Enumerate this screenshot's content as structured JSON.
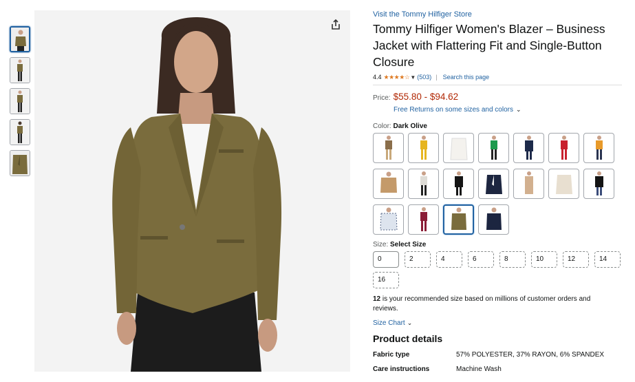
{
  "store_link": "Visit the Tommy Hilfiger Store",
  "product_title": "Tommy Hilfiger Women's Blazer – Business Jacket with Flattering Fit and Single-Button Closure",
  "rating": {
    "value": "4.4",
    "stars": "★★★★☆",
    "stars_out_of_5": 4.4,
    "reviews": "(503)",
    "separator": "|",
    "search_link": "Search this page"
  },
  "price": {
    "label": "Price:",
    "range": "$55.80 - $94.62",
    "returns_text": "Free Returns on some sizes and colors"
  },
  "color": {
    "label": "Color:",
    "selected": "Dark Olive"
  },
  "size": {
    "label": "Size:",
    "selected": "Select Size",
    "options": [
      "0",
      "2",
      "4",
      "6",
      "8",
      "10",
      "12",
      "14",
      "16"
    ]
  },
  "recommendation": {
    "size": "12",
    "text": " is your recommended size based on millions of customer orders and reviews."
  },
  "size_chart_link": "Size Chart",
  "product_details": {
    "heading": "Product details",
    "rows": [
      {
        "key": "Fabric type",
        "value": "57% POLYESTER, 37% RAYON, 6% SPANDEX"
      },
      {
        "key": "Care instructions",
        "value": "Machine Wash"
      }
    ]
  },
  "colors": {
    "main_blazer": "#7a6c3d",
    "link": "#2162a1",
    "price": "#b12704",
    "star": "#de7921"
  },
  "icons": {
    "share": "share-icon",
    "chevron": "chevron-down-icon"
  }
}
